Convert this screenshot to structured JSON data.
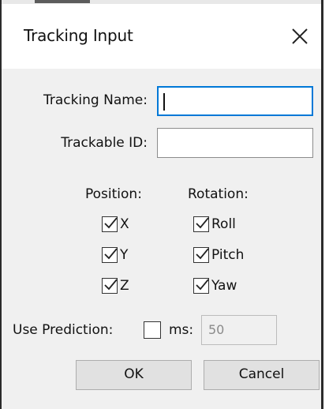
{
  "window": {
    "title": "Tracking Input",
    "close_icon": "close-icon"
  },
  "form": {
    "tracking_name_label": "Tracking Name:",
    "tracking_name_value": "",
    "trackable_id_label": "Trackable ID:",
    "trackable_id_value": ""
  },
  "position": {
    "header": "Position:",
    "items": [
      {
        "label": "X",
        "checked": true
      },
      {
        "label": "Y",
        "checked": true
      },
      {
        "label": "Z",
        "checked": true
      }
    ]
  },
  "rotation": {
    "header": "Rotation:",
    "items": [
      {
        "label": "Roll",
        "checked": true
      },
      {
        "label": "Pitch",
        "checked": true
      },
      {
        "label": "Yaw",
        "checked": true
      }
    ]
  },
  "prediction": {
    "label": "Use Prediction:",
    "checked": false,
    "ms_label": "ms:",
    "ms_value": "50"
  },
  "buttons": {
    "ok": "OK",
    "cancel": "Cancel"
  },
  "colors": {
    "focus_border": "#0078d7",
    "dialog_bg": "#f0f0f0",
    "button_bg": "#e1e1e1"
  }
}
